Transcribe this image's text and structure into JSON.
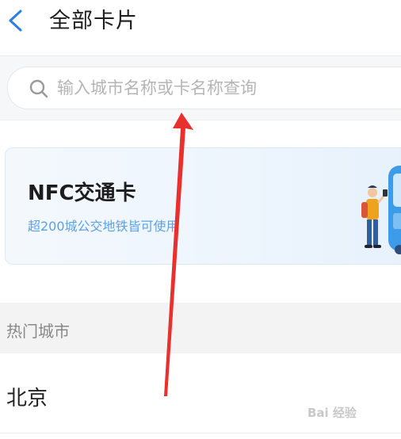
{
  "header": {
    "back_icon": "chevron-left-icon",
    "title": "全部卡片"
  },
  "search": {
    "icon": "search-icon",
    "value": "",
    "placeholder": "输入城市名称或卡名称查询"
  },
  "nfc_card": {
    "title": "NFC交通卡",
    "subtitle": "超200城公交地铁皆可使用",
    "illustration": "bus-traveler-illustration",
    "accent_color": "#5aa2e6"
  },
  "hot_cities": {
    "label": "热门城市",
    "items": [
      {
        "name": "北京"
      }
    ]
  },
  "annotation": {
    "arrow_color": "#e8302e"
  },
  "watermark": {
    "text": "Bai 经验"
  }
}
